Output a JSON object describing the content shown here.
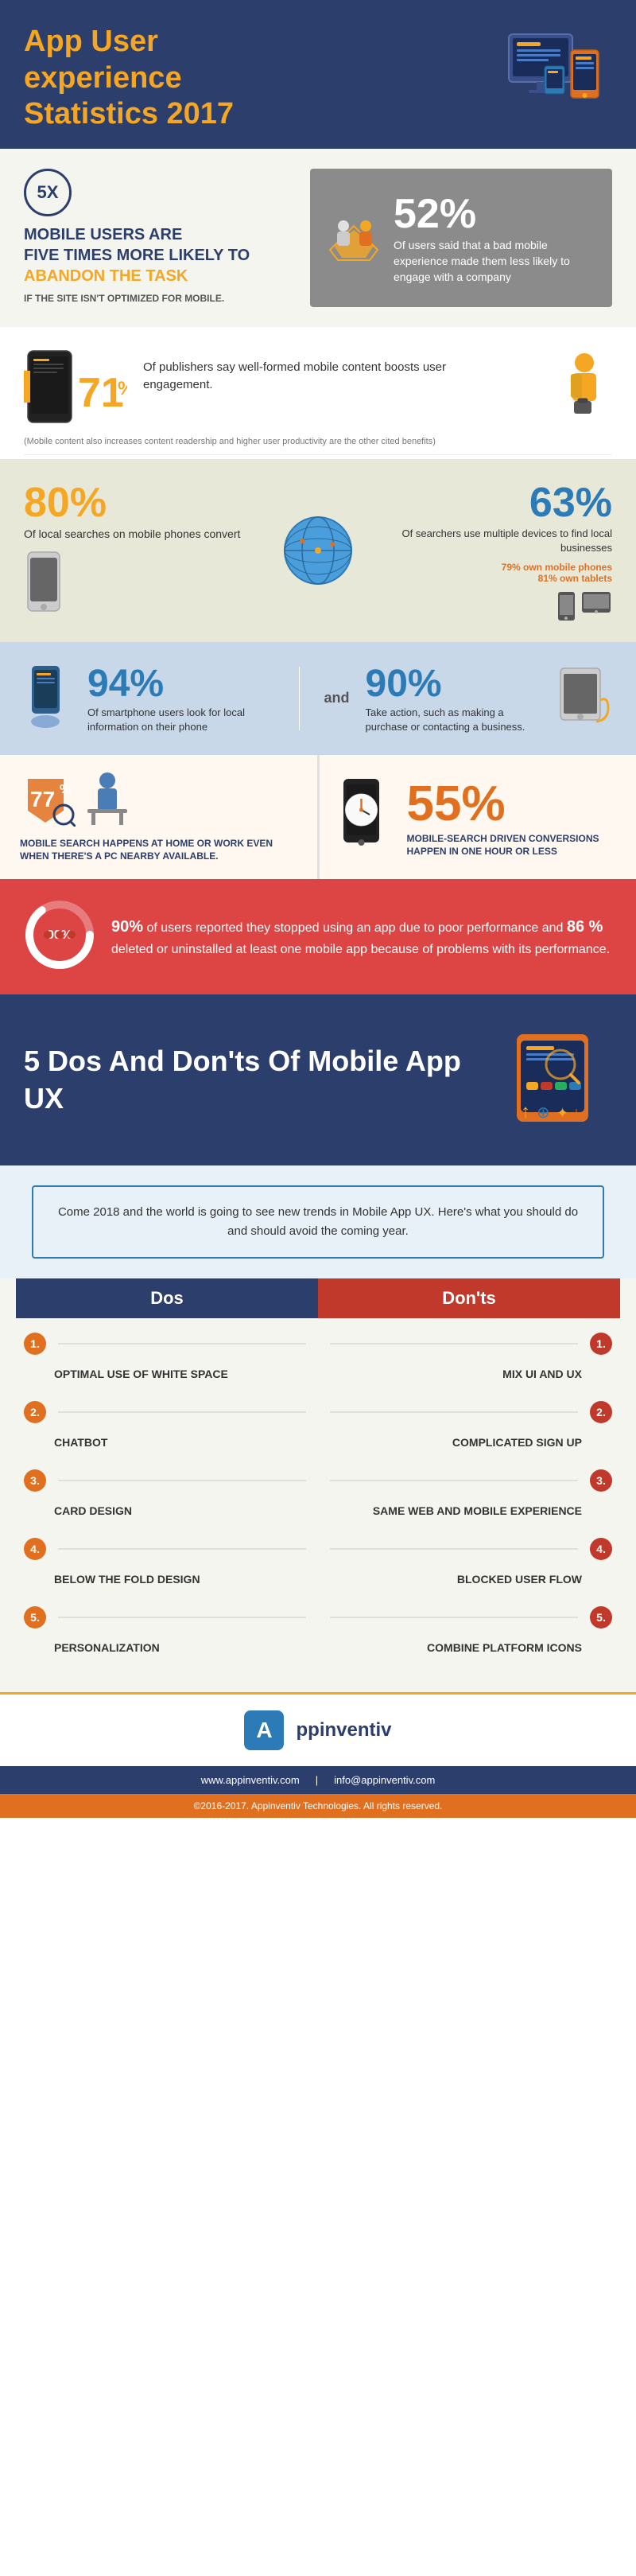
{
  "header": {
    "title_line1": "App User",
    "title_line2": "experience",
    "title_line3": "Statistics",
    "title_year": "2017"
  },
  "section_5x": {
    "multiplier": "5X",
    "line1": "MOBILE USERS ARE",
    "line2": "FIVE TIMES MORE LIKELY TO",
    "line3": "ABANDON THE TASK",
    "line4": "IF THE SITE ISN'T OPTIMIZED FOR MOBILE."
  },
  "section_52": {
    "percent": "52%",
    "text": "Of users  said that a bad mobile experience made them less likely to engage with a company"
  },
  "section_71": {
    "percent": "71%",
    "text": "Of publishers say well-formed mobile content boosts user engagement.",
    "footnote": "(Mobile content also increases content readership and higher user productivity are the other cited benefits)"
  },
  "section_80": {
    "percent": "80%",
    "text": "Of local searches on mobile phones convert"
  },
  "section_63": {
    "percent": "63%",
    "text": "Of searchers use multiple devices to find local businesses",
    "sub1": "79% own mobile phones",
    "sub2": "81% own tablets"
  },
  "section_94": {
    "percent": "94%",
    "text": "Of smartphone users look for local information on their phone",
    "and": "and",
    "percent_90": "90%",
    "text_90": "Take action, such as making a purchase or contacting a business."
  },
  "section_77": {
    "percent": "77%",
    "text": "MOBILE SEARCH HAPPENS AT HOME OR WORK EVEN WHEN THERE'S A PC NEARBY AVAILABLE."
  },
  "section_55": {
    "percent": "55%",
    "text": "MOBILE-SEARCH DRIVEN CONVERSIONS HAPPEN IN ONE HOUR OR LESS"
  },
  "section_perf": {
    "donut_label": "90%",
    "text1": "90%",
    "text2": " of users reported they stopped using an app due to poor performance and ",
    "text3": "86 %",
    "text4": " deleted or uninstalled at least one mobile app because of problems with its performance."
  },
  "section_5dos_header": {
    "title": "5 Dos And Don'ts Of Mobile App UX"
  },
  "section_come2018": {
    "text": "Come 2018 and the world is going to see new trends in Mobile App UX. Here's what you should do and should avoid the coming year."
  },
  "dos_header": "Dos",
  "donts_header": "Don'ts",
  "dos_items": [
    "OPTIMAL USE OF WHITE SPACE",
    "CHATBOT",
    "CARD DESIGN",
    "BELOW THE FOLD DESIGN",
    "PERSONALIZATION"
  ],
  "donts_items": [
    "MIX UI AND UX",
    "COMPLICATED SIGN UP",
    "SAME WEB AND MOBILE EXPERIENCE",
    "BLOCKED USER FLOW",
    "COMBINE PLATFORM ICONS"
  ],
  "footer": {
    "logo_letter": "A",
    "logo_name_bold": "pp",
    "logo_name_rest": "inventiv",
    "link1": "www.appinventiv.com",
    "separator": "|",
    "link2": "info@appinventiv.com",
    "copyright": "©2016-2017. Appinventiv Technologies. All rights reserved."
  }
}
